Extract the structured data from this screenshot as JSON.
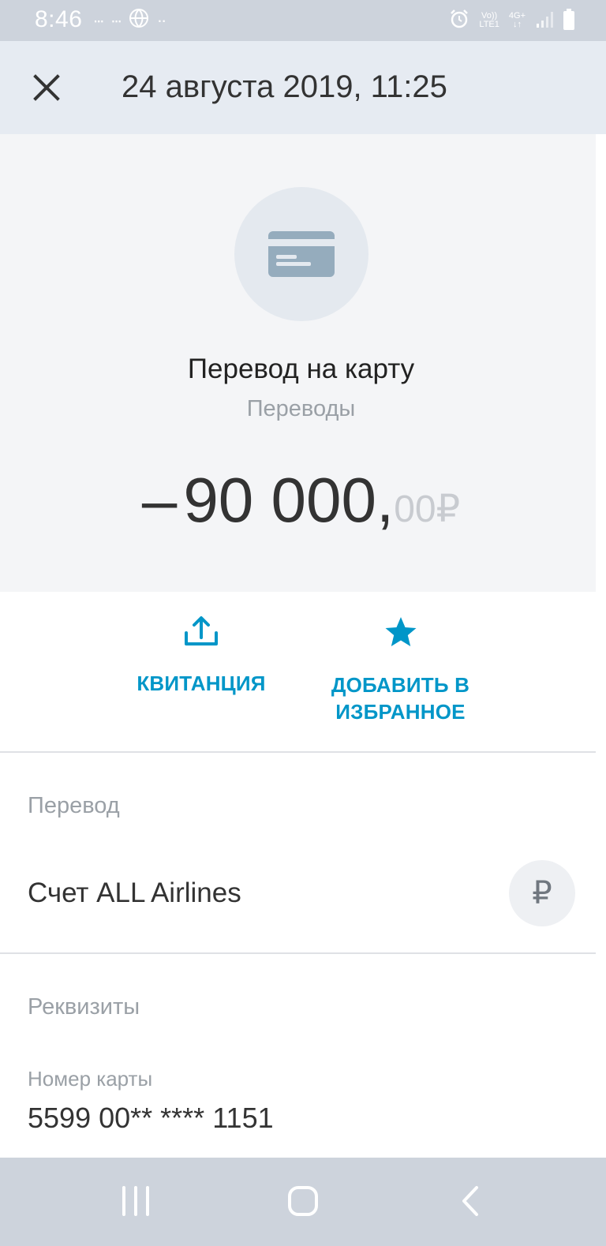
{
  "status_bar": {
    "time": "8:46",
    "left_icons": [
      "taxi-icon",
      "taxi-icon",
      "globe-icon",
      "more-dots-icon"
    ],
    "right_icons": [
      "alarm-icon",
      "volte-icon",
      "network-4g-icon",
      "signal-icon",
      "battery-icon"
    ],
    "volte_top": "Vo))",
    "volte_bottom": "LTE1",
    "network_top": "4G+",
    "network_bottom": "↓↑"
  },
  "header": {
    "title": "24 августа 2019, 11:25",
    "close_icon": "close-icon"
  },
  "operation": {
    "icon": "card-icon",
    "title": "Перевод на карту",
    "category": "Переводы",
    "amount_sign": "–",
    "amount_main": "90 000,",
    "amount_cents": "00",
    "currency_symbol": "₽"
  },
  "actions": {
    "receipt_label": "КВИТАНЦИЯ",
    "receipt_icon": "share-upload-icon",
    "favorite_label_line1": "ДОБАВИТЬ В",
    "favorite_label_line2": "ИЗБРАННОЕ",
    "favorite_icon": "star-icon"
  },
  "transfer": {
    "section_label": "Перевод",
    "account_name": "Счет ALL Airlines",
    "currency_symbol": "₽"
  },
  "details": {
    "section_label": "Реквизиты",
    "card_number_label": "Номер карты",
    "card_number_value": "5599 00** **** 1151"
  },
  "nav_bar": {
    "buttons": [
      "recents-icon",
      "home-icon",
      "back-icon"
    ]
  },
  "colors": {
    "status_bar": "#cdd3dc",
    "app_bar": "#e6ebf2",
    "summary_bg": "#f4f5f7",
    "accent": "#0096c8",
    "text_primary": "#333333",
    "text_secondary": "#9aa0a6"
  }
}
